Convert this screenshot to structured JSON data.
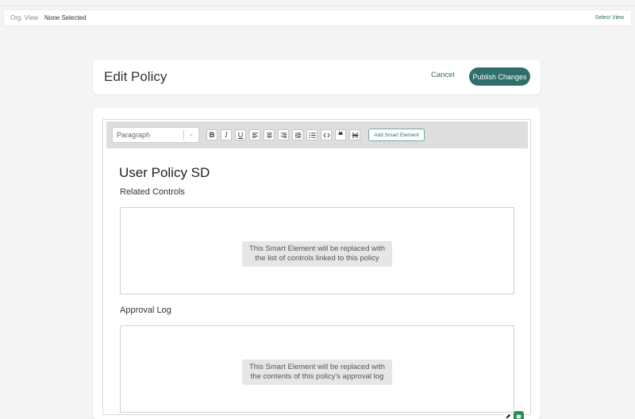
{
  "org_bar": {
    "label": "Org. View",
    "value": "None Selected",
    "select_link": "Select View"
  },
  "header": {
    "title": "Edit Policy",
    "cancel_label": "Cancel",
    "publish_label": "Publish Changes"
  },
  "toolbar": {
    "paragraph_select": "Paragraph",
    "buttons": [
      "bold-icon",
      "italic-icon",
      "underline-icon",
      "align-left-icon",
      "align-center-icon",
      "align-right-icon",
      "indent-icon",
      "list-icon",
      "code-icon",
      "quote-icon",
      "page-break-icon"
    ],
    "add_smart_element": "Add Smart Element"
  },
  "document": {
    "title": "User Policy SD",
    "sections": [
      {
        "heading": "Related Controls",
        "placeholder_line1": "This Smart Element will be replaced with",
        "placeholder_line2": "the list of controls linked to this policy"
      },
      {
        "heading": "Approval Log",
        "placeholder_line1": "This Smart Element will be replaced with",
        "placeholder_line2": "the contents of this policy's approval log"
      }
    ]
  },
  "colors": {
    "accent": "#2f6f6a",
    "toolbar_bg": "#dedede",
    "page_bg": "#f4f4f4"
  }
}
